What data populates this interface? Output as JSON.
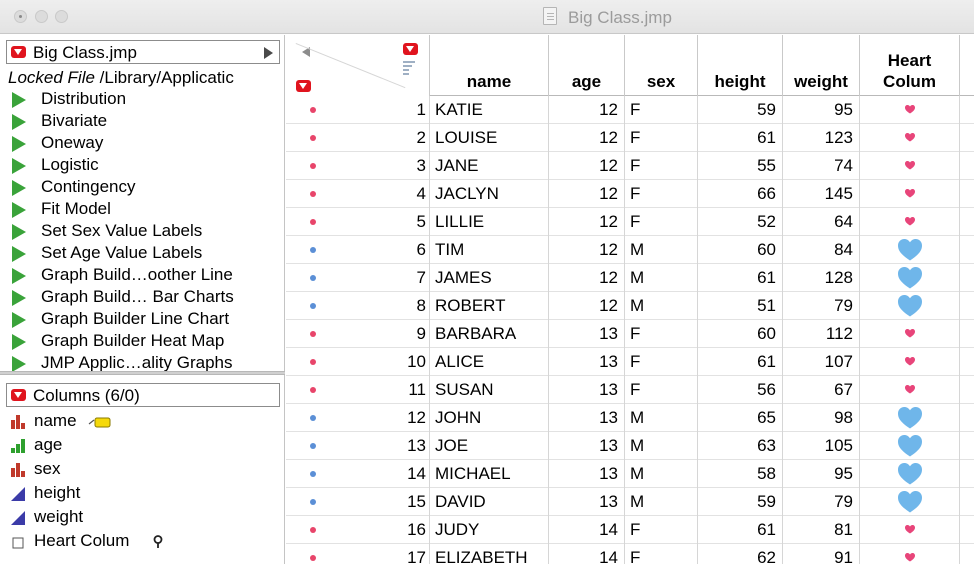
{
  "window": {
    "title": "Big Class.jmp"
  },
  "left_panel": {
    "table_name": "Big Class.jmp",
    "locked_label": "Locked File",
    "path": "/Library/Applicatic",
    "scripts": [
      {
        "label": "Distribution"
      },
      {
        "label": "Bivariate"
      },
      {
        "label": "Oneway"
      },
      {
        "label": "Logistic"
      },
      {
        "label": "Contingency"
      },
      {
        "label": "Fit Model"
      },
      {
        "label": "Set Sex Value Labels"
      },
      {
        "label": "Set Age Value Labels"
      },
      {
        "label": "Graph Build…oother Line"
      },
      {
        "label": "Graph Build… Bar Charts"
      },
      {
        "label": "Graph Builder Line Chart"
      },
      {
        "label": "Graph Builder Heat Map"
      },
      {
        "label": "JMP Applic…ality Graphs"
      }
    ],
    "columns_header": "Columns (6/0)",
    "columns": [
      {
        "label": "name",
        "icon": "nominal-icon",
        "color": "#c0392b"
      },
      {
        "label": "age",
        "icon": "ordinal-icon",
        "color": "#2ea02e"
      },
      {
        "label": "sex",
        "icon": "nominal-icon",
        "color": "#c0392b"
      },
      {
        "label": "height",
        "icon": "continuous-icon",
        "color": "#3b3ba8"
      },
      {
        "label": "weight",
        "icon": "continuous-icon",
        "color": "#3b3ba8"
      },
      {
        "label": "Heart Colum",
        "icon": "expression-icon",
        "color": "#555555"
      }
    ]
  },
  "grid": {
    "headers": {
      "name": "name",
      "age": "age",
      "sex": "sex",
      "height": "height",
      "weight": "weight",
      "heart_line1": "Heart",
      "heart_line2": "Colum"
    },
    "colors": {
      "female": "#e8456a",
      "male": "#5b8fd6",
      "heart_female": "#e8457a",
      "heart_male": "#6fb6ea"
    },
    "rows": [
      {
        "n": "1",
        "name": "KATIE",
        "age": "12",
        "sex": "F",
        "height": "59",
        "weight": "95"
      },
      {
        "n": "2",
        "name": "LOUISE",
        "age": "12",
        "sex": "F",
        "height": "61",
        "weight": "123"
      },
      {
        "n": "3",
        "name": "JANE",
        "age": "12",
        "sex": "F",
        "height": "55",
        "weight": "74"
      },
      {
        "n": "4",
        "name": "JACLYN",
        "age": "12",
        "sex": "F",
        "height": "66",
        "weight": "145"
      },
      {
        "n": "5",
        "name": "LILLIE",
        "age": "12",
        "sex": "F",
        "height": "52",
        "weight": "64"
      },
      {
        "n": "6",
        "name": "TIM",
        "age": "12",
        "sex": "M",
        "height": "60",
        "weight": "84"
      },
      {
        "n": "7",
        "name": "JAMES",
        "age": "12",
        "sex": "M",
        "height": "61",
        "weight": "128"
      },
      {
        "n": "8",
        "name": "ROBERT",
        "age": "12",
        "sex": "M",
        "height": "51",
        "weight": "79"
      },
      {
        "n": "9",
        "name": "BARBARA",
        "age": "13",
        "sex": "F",
        "height": "60",
        "weight": "112"
      },
      {
        "n": "10",
        "name": "ALICE",
        "age": "13",
        "sex": "F",
        "height": "61",
        "weight": "107"
      },
      {
        "n": "11",
        "name": "SUSAN",
        "age": "13",
        "sex": "F",
        "height": "56",
        "weight": "67"
      },
      {
        "n": "12",
        "name": "JOHN",
        "age": "13",
        "sex": "M",
        "height": "65",
        "weight": "98"
      },
      {
        "n": "13",
        "name": "JOE",
        "age": "13",
        "sex": "M",
        "height": "63",
        "weight": "105"
      },
      {
        "n": "14",
        "name": "MICHAEL",
        "age": "13",
        "sex": "M",
        "height": "58",
        "weight": "95"
      },
      {
        "n": "15",
        "name": "DAVID",
        "age": "13",
        "sex": "M",
        "height": "59",
        "weight": "79"
      },
      {
        "n": "16",
        "name": "JUDY",
        "age": "14",
        "sex": "F",
        "height": "61",
        "weight": "81"
      },
      {
        "n": "17",
        "name": "ELIZABETH",
        "age": "14",
        "sex": "F",
        "height": "62",
        "weight": "91"
      }
    ]
  }
}
